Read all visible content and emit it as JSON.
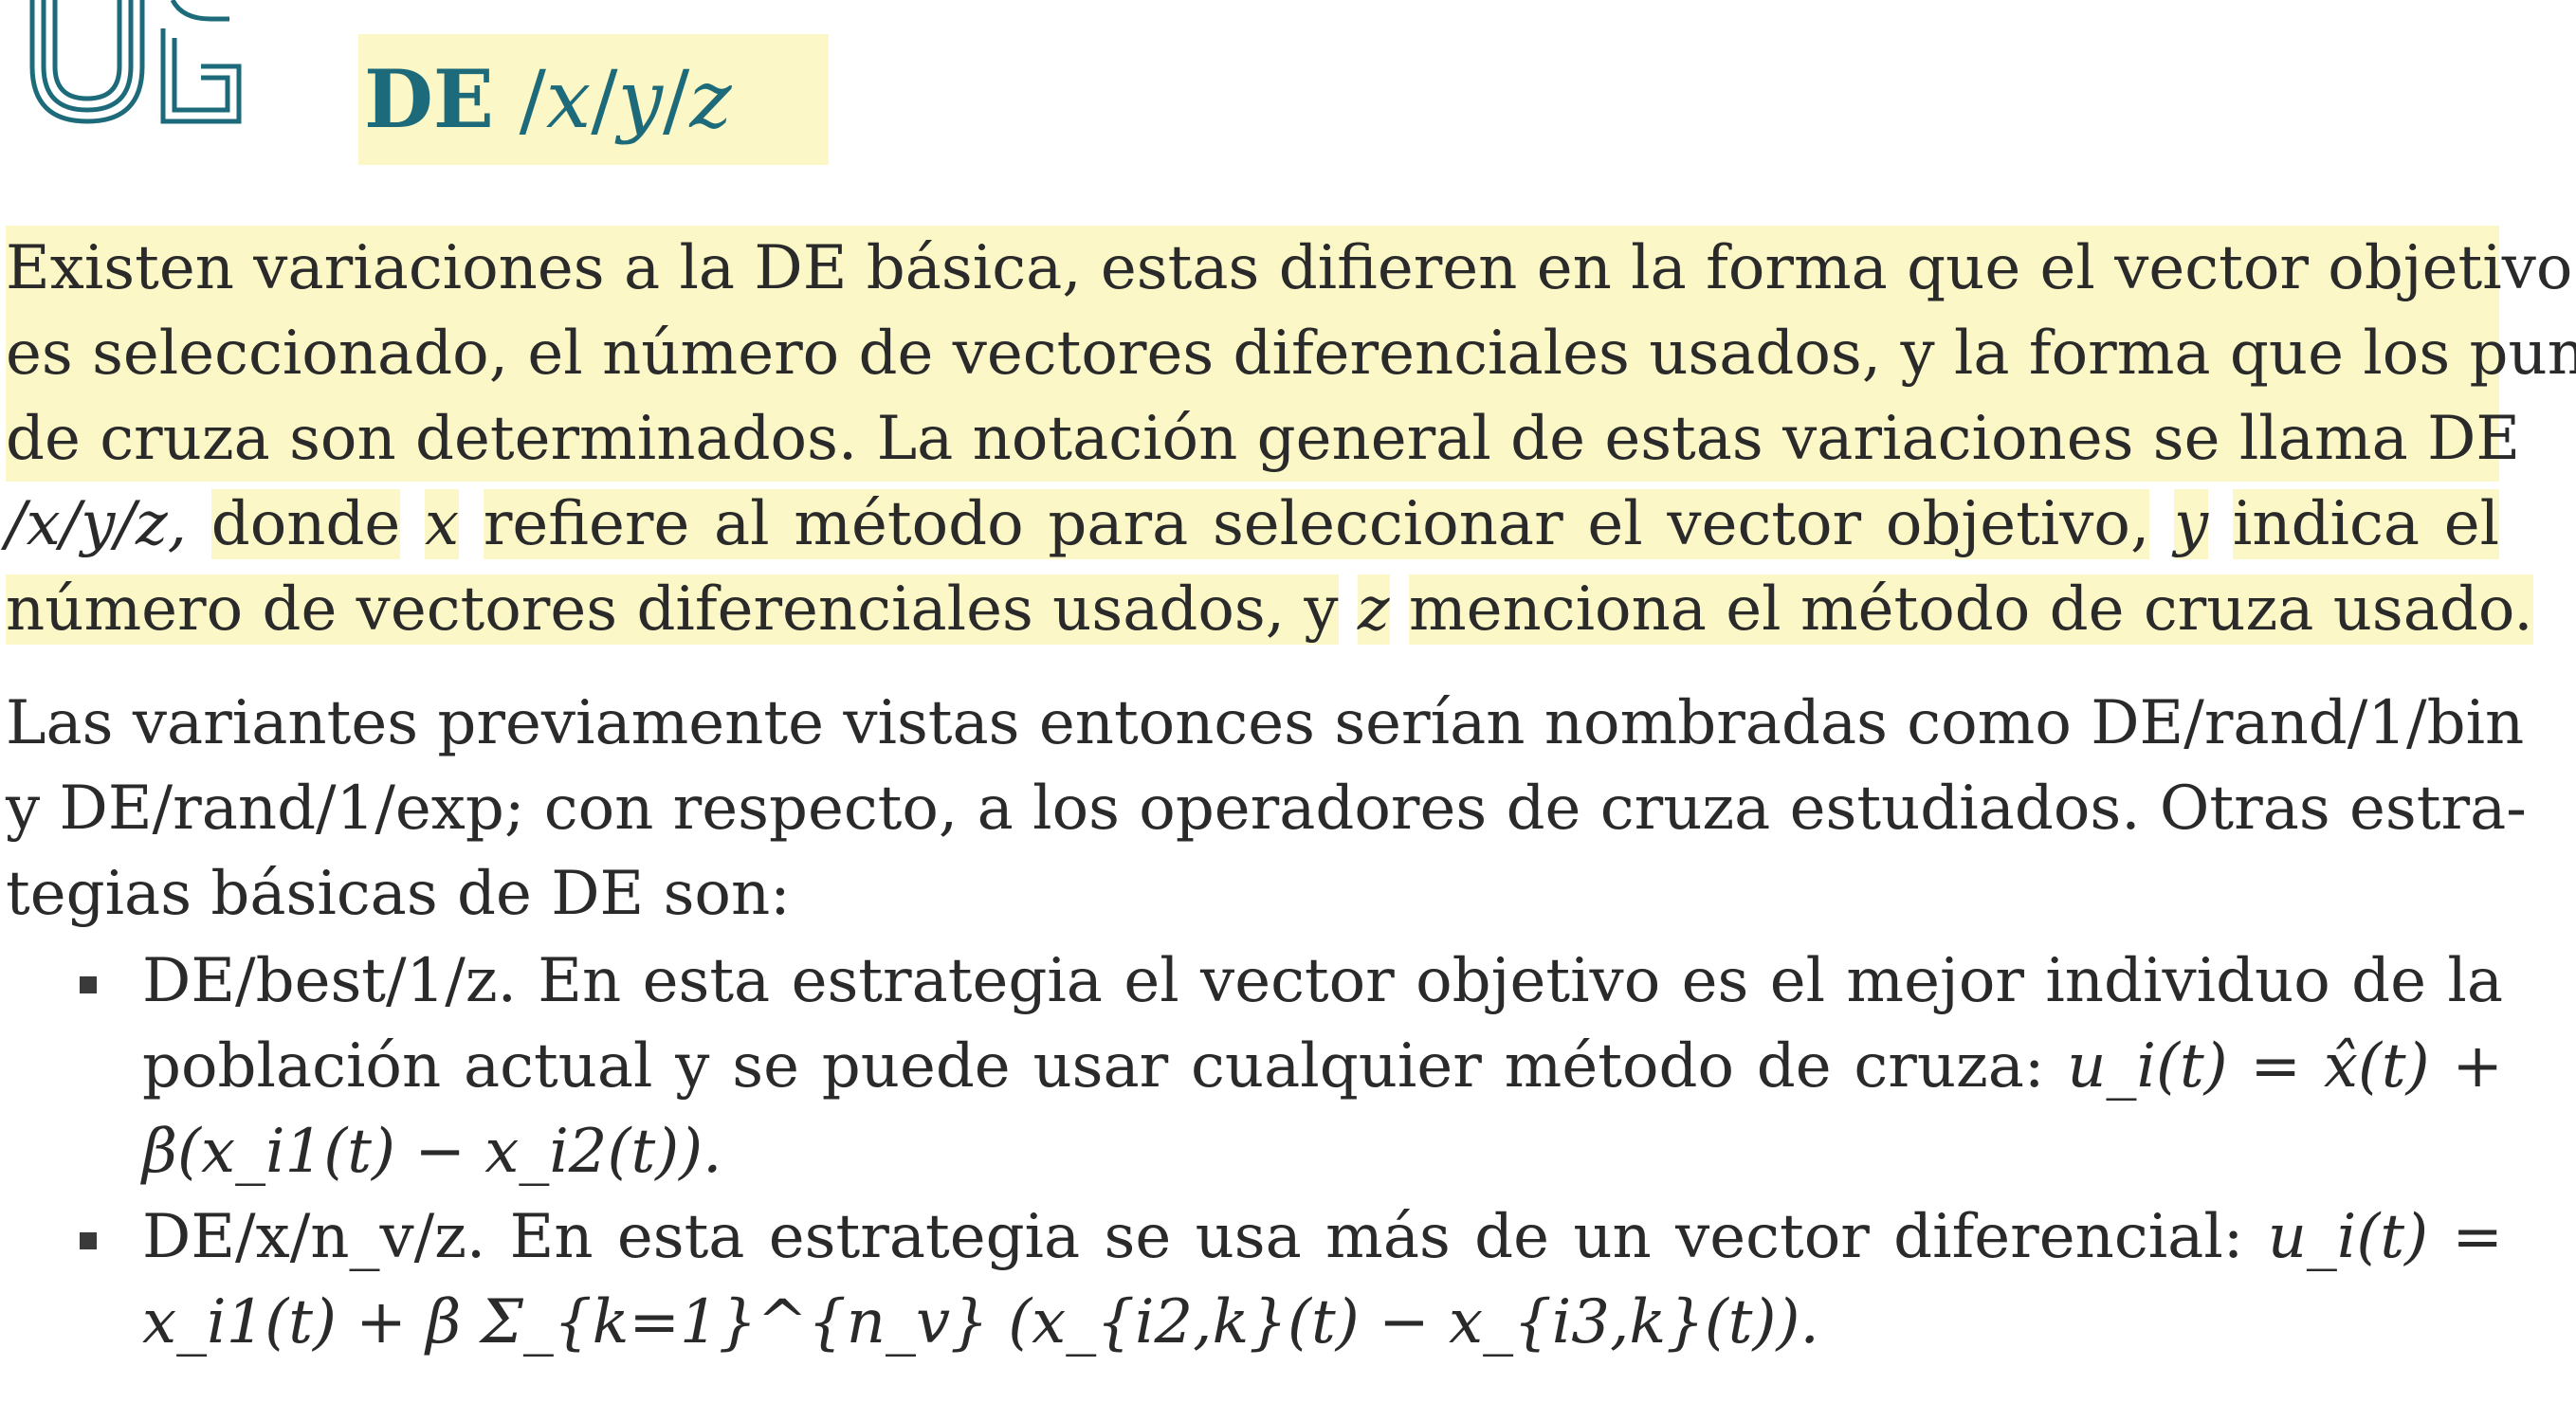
{
  "header": {
    "title_prefix": "DE",
    "title_x": "x",
    "title_y": "y",
    "title_z": "z"
  },
  "paragraph1": {
    "line1": "Existen variaciones a la DE básica, estas difieren en la forma que el vector objetivo",
    "line2": "es seleccionado, el número de vectores diferenciales usados, y la forma que los puntos",
    "line3": "de cruza son determinados. La notación general de estas variaciones se llama DE",
    "line4a": "/x/y/z,",
    "line4b": "donde",
    "line4c": "x",
    "line4d": "refiere al método para seleccionar el vector objetivo,",
    "line4e": "y",
    "line4f": "indica el",
    "line5a": "número de vectores diferenciales usados, y",
    "line5b": "z",
    "line5c": "menciona el método de cruza usado."
  },
  "paragraph2": {
    "line1": "Las variantes previamente vistas entonces serían nombradas como DE/rand/1/bin",
    "line2": "y DE/rand/1/exp; con respecto, a los operadores de cruza estudiados. Otras estra-",
    "line3": "tegias básicas de DE son:"
  },
  "bullets": [
    {
      "name": "DE/best/1/z.",
      "line1": "En esta estrategia el vector objetivo es el mejor individuo de la",
      "line2": "población actual y se puede usar cualquier método de cruza:",
      "formula_a": "u_i(t) = x̂(t) +",
      "formula_b": "β(x_i1(t) − x_i2(t))."
    },
    {
      "name": "DE/x/n_v/z.",
      "line1": "En esta estrategia se usa más de un vector diferencial:",
      "formula_a": "u_i(t) =",
      "formula_b": "x_i1(t) + β Σ_{k=1}^{n_v} (x_{i2,k}(t) − x_{i3,k}(t))."
    }
  ],
  "colors": {
    "title": "#1d6b7a",
    "highlight": "#fbf7c6",
    "logo": "#1d6b7a"
  }
}
